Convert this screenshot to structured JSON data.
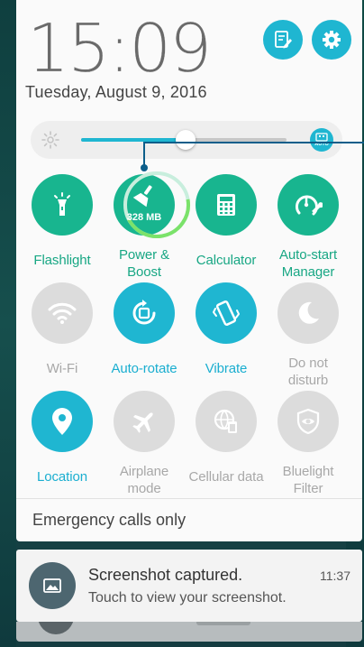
{
  "header": {
    "time": "15:09",
    "date": "Tuesday, August 9, 2016",
    "edit_icon": "edit-icon",
    "settings_icon": "gear-icon"
  },
  "brightness": {
    "level": 0.51,
    "auto_label": "AUTO"
  },
  "tiles": [
    {
      "label": "Flashlight",
      "state": "on",
      "icon": "flashlight-icon"
    },
    {
      "label": "Power &\nBoost",
      "state": "on",
      "icon": "broom-icon",
      "memory": "328 MB"
    },
    {
      "label": "Calculator",
      "state": "on",
      "icon": "calculator-icon"
    },
    {
      "label": "Auto-start\nManager",
      "state": "on",
      "icon": "speedometer-wrench-icon"
    },
    {
      "label": "Wi-Fi",
      "state": "off",
      "icon": "wifi-icon"
    },
    {
      "label": "Auto-rotate",
      "state": "on",
      "icon": "rotate-icon"
    },
    {
      "label": "Vibrate",
      "state": "on",
      "icon": "vibrate-icon"
    },
    {
      "label": "Do not\ndisturb",
      "state": "off",
      "icon": "moon-icon"
    },
    {
      "label": "Location",
      "state": "on",
      "icon": "location-pin-icon"
    },
    {
      "label": "Airplane\nmode",
      "state": "off",
      "icon": "airplane-icon"
    },
    {
      "label": "Cellular data",
      "state": "off",
      "icon": "cellular-data-icon"
    },
    {
      "label": "Bluelight\nFilter",
      "state": "off",
      "icon": "eye-shield-icon"
    }
  ],
  "emergency_text": "Emergency calls only",
  "notification": {
    "title": "Screenshot captured.",
    "body": "Touch to view your screenshot.",
    "time": "11:37",
    "icon": "image-icon"
  },
  "colors": {
    "green": "#18b58f",
    "cyan": "#1fb6d1",
    "inactive": "#dcdcdc"
  }
}
